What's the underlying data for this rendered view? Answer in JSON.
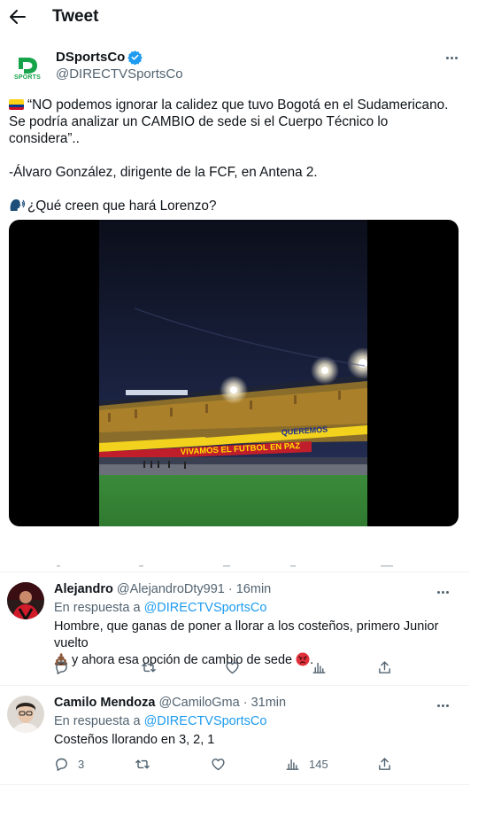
{
  "header": {
    "title": "Tweet"
  },
  "tweet": {
    "author_name": "DSportsCo",
    "author_handle": "@DIRECTVSportsCo",
    "logo_text": "SPORTS",
    "paragraphs": [
      "“NO podemos ignorar la calidez que tuvo Bogotá en el Sudamericano. Se podría analizar un CAMBIO de sede si el Cuerpo Técnico lo considera”..",
      "-Álvaro González, dirigente de la FCF, en Antena 2.",
      "¿Qué creen que hará Lorenzo?"
    ],
    "video_banners": [
      "QUEREMOS",
      "VIVAMOS EL FUTBOL EN PAZ"
    ]
  },
  "replies": [
    {
      "name": "Alejandro",
      "handle": "@AlejandroDty991",
      "time": "· 16min",
      "replying_prefix": "En respuesta a ",
      "replying_to": "@DIRECTVSportsCo",
      "text_line1": "Hombre, que ganas de poner a llorar a los costeños, primero Junior vuelto",
      "text_line2": " y ahora esa opción de cambio de sede ",
      "text_end": ".",
      "counts": {
        "reply": "",
        "retweet": "",
        "like": "",
        "views": ""
      }
    },
    {
      "name": "Camilo Mendoza",
      "handle": "@CamiloGma",
      "time": "· 31min",
      "replying_prefix": "En respuesta a ",
      "replying_to": "@DIRECTVSportsCo",
      "text_line1": "Costeños llorando en 3, 2, 1",
      "counts": {
        "reply": "3",
        "retweet": "",
        "like": "",
        "views": "145"
      }
    }
  ],
  "colors": {
    "accent": "#1d9bf0",
    "verified": "#1d9bf0",
    "muted": "#536471",
    "text": "#0f1419"
  },
  "icons": [
    "back-arrow-icon",
    "verified-badge-icon",
    "more-icon",
    "colombia-flag-icon",
    "speaking-head-icon",
    "reply-icon",
    "retweet-icon",
    "like-icon",
    "views-icon",
    "share-icon",
    "poop-emoji-icon",
    "angry-face-emoji-icon"
  ]
}
